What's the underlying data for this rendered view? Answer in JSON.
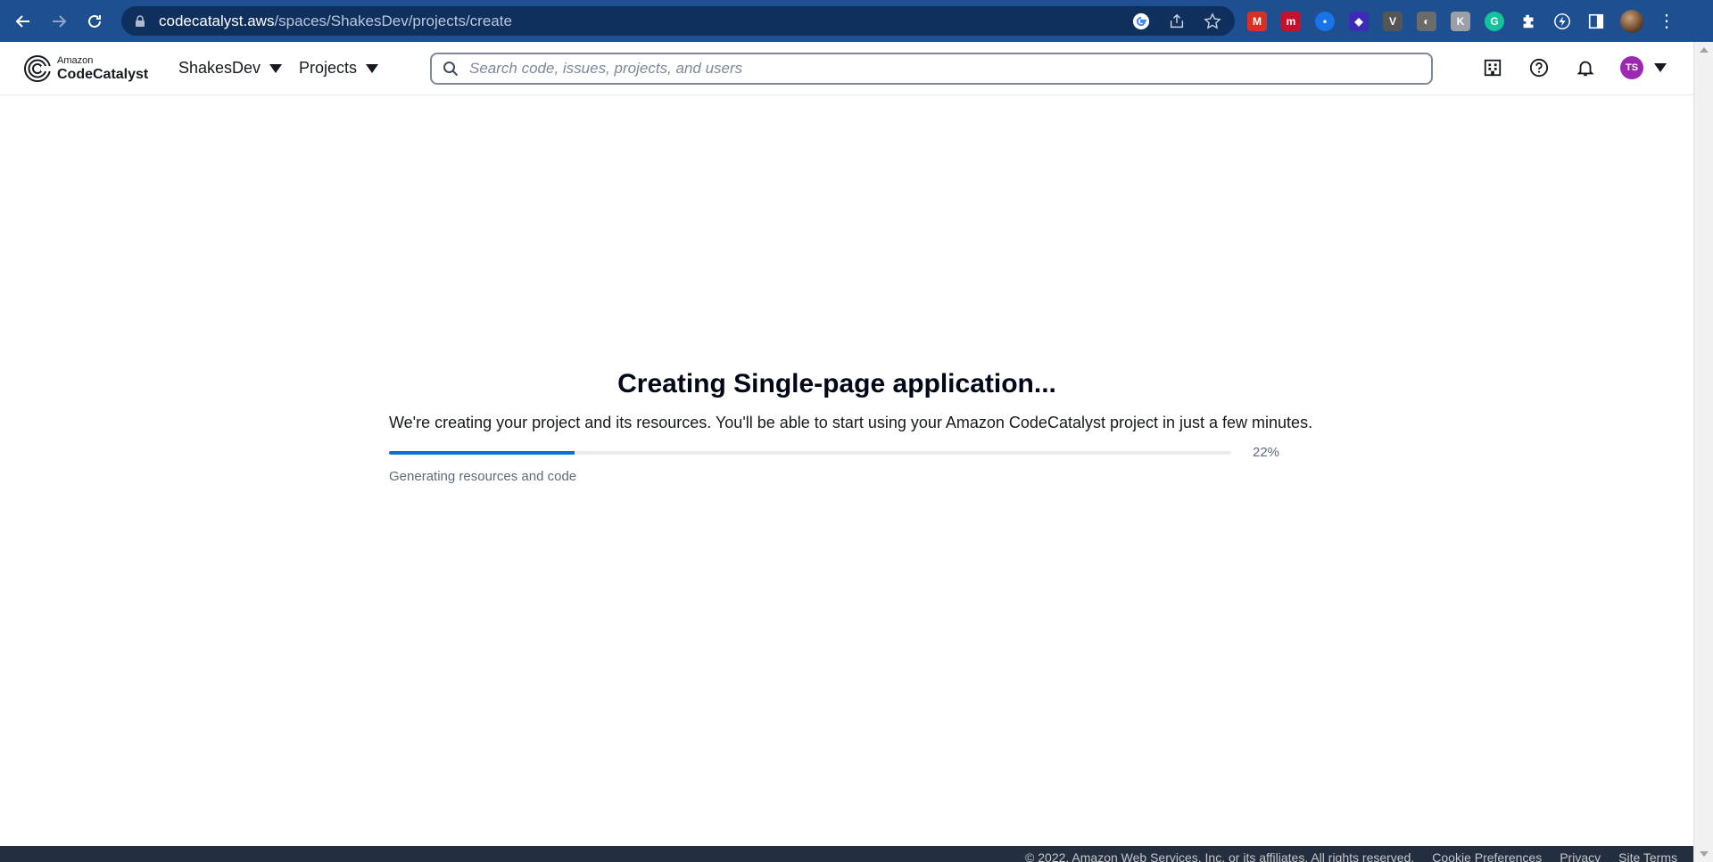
{
  "browser": {
    "url_host": "codecatalyst.aws",
    "url_path": "/spaces/ShakesDev/projects/create",
    "extensions": [
      {
        "name": "gmail-extension-icon",
        "letter": "M",
        "color": "#d93025"
      },
      {
        "name": "mendeley-extension-icon",
        "letter": "m",
        "color": "#c8102e"
      },
      {
        "name": "pin-extension-icon",
        "letter": "•",
        "color": "#1a73e8"
      },
      {
        "name": "layers-extension-icon",
        "letter": "◆",
        "color": "#3b2bb5"
      },
      {
        "name": "vuetify-extension-icon",
        "letter": "V",
        "color": "#555555"
      },
      {
        "name": "mask-extension-icon",
        "letter": "◐",
        "color": "#6b6b6b"
      },
      {
        "name": "k-extension-icon",
        "letter": "K",
        "color": "#9aa0a6"
      },
      {
        "name": "grammarly-extension-icon",
        "letter": "G",
        "color": "#15c39a"
      }
    ]
  },
  "header": {
    "logo_small": "Amazon",
    "logo_big": "CodeCatalyst",
    "space_menu": "ShakesDev",
    "projects_menu": "Projects",
    "search_placeholder": "Search code, issues, projects, and users",
    "avatar_initials": "TS"
  },
  "main": {
    "title": "Creating Single-page application...",
    "description": "We're creating your project and its resources. You'll be able to start using your Amazon CodeCatalyst project in just a few minutes.",
    "progress_value": 0.22,
    "progress_text": "22%",
    "progress_label": "Generating resources and code"
  },
  "footer": {
    "copyright": "© 2022, Amazon Web Services, Inc. or its affiliates. All rights reserved.",
    "cookie": "Cookie Preferences",
    "privacy": "Privacy",
    "terms": "Site Terms"
  },
  "colors": {
    "chrome_bar": "#1d4f91",
    "progress_fill": "#0972d3",
    "avatar_bg": "#9c27b0",
    "footer_bg": "#232f3e"
  }
}
